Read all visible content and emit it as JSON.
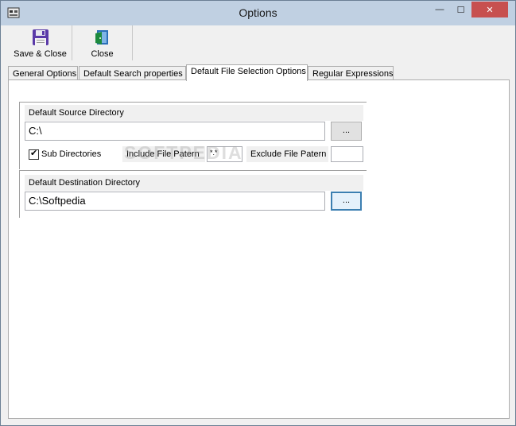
{
  "window": {
    "title": "Options",
    "controls": {
      "minimize": "—",
      "maximize": "☐",
      "close": "✕"
    }
  },
  "toolbar": {
    "save_close_label": "Save & Close",
    "close_label": "Close"
  },
  "tabs": [
    {
      "label": "General Options",
      "active": false
    },
    {
      "label": "Default Search properties",
      "active": false
    },
    {
      "label": "Default File Selection Options",
      "active": true
    },
    {
      "label": "Regular Expressions",
      "active": false
    }
  ],
  "source": {
    "label": "Default Source Directory",
    "value": "C:\\",
    "browse_label": "...",
    "sub_directories_label": "Sub Directories",
    "sub_directories_checked": true,
    "include_label": "Include File Patern",
    "include_value": "*.*",
    "exclude_label": "Exclude File Patern",
    "exclude_value": ""
  },
  "destination": {
    "label": "Default Destination Directory",
    "value": "C:\\Softpedia",
    "browse_label": "..."
  },
  "watermark": "SOFTPEDIA",
  "colors": {
    "titlebar": "#c0d0e2",
    "close_button": "#c7504f",
    "focused_button_border": "#3c7fb1"
  }
}
